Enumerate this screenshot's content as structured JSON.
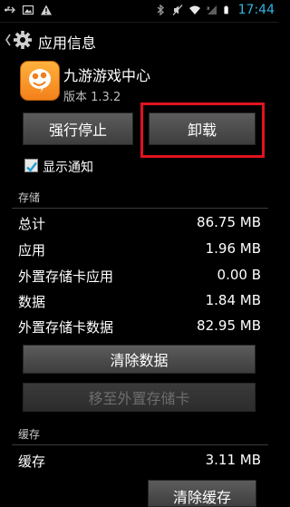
{
  "status_bar": {
    "time": "17:44",
    "time_color": "#33b5e5",
    "icons_left": [
      "usb-icon",
      "image-icon",
      "warning-icon"
    ],
    "icons_right": [
      "bluetooth-icon",
      "mute-icon",
      "wifi-icon",
      "signal-icon",
      "battery-icon"
    ]
  },
  "action_bar": {
    "title": "应用信息",
    "icon": "settings-gear-icon"
  },
  "app": {
    "name": "九游游戏中心",
    "version": "版本 1.3.2",
    "icon": "app-logo-icon"
  },
  "buttons": {
    "force_stop": "强行停止",
    "uninstall": "卸载",
    "clear_data": "清除数据",
    "move_to_sd": "移至外置存储卡",
    "clear_cache": "清除缓存"
  },
  "notification_checkbox": {
    "label": "显示通知",
    "checked": true
  },
  "highlight_color": "#e0131f",
  "storage": {
    "header": "存储",
    "rows": [
      {
        "label": "总计",
        "value": "86.75 MB"
      },
      {
        "label": "应用",
        "value": "1.96 MB"
      },
      {
        "label": "外置存储卡应用",
        "value": "0.00 B"
      },
      {
        "label": "数据",
        "value": "1.84 MB"
      },
      {
        "label": "外置存储卡数据",
        "value": "82.95 MB"
      }
    ]
  },
  "cache": {
    "header": "缓存",
    "rows": [
      {
        "label": "缓存",
        "value": "3.11 MB"
      }
    ]
  }
}
